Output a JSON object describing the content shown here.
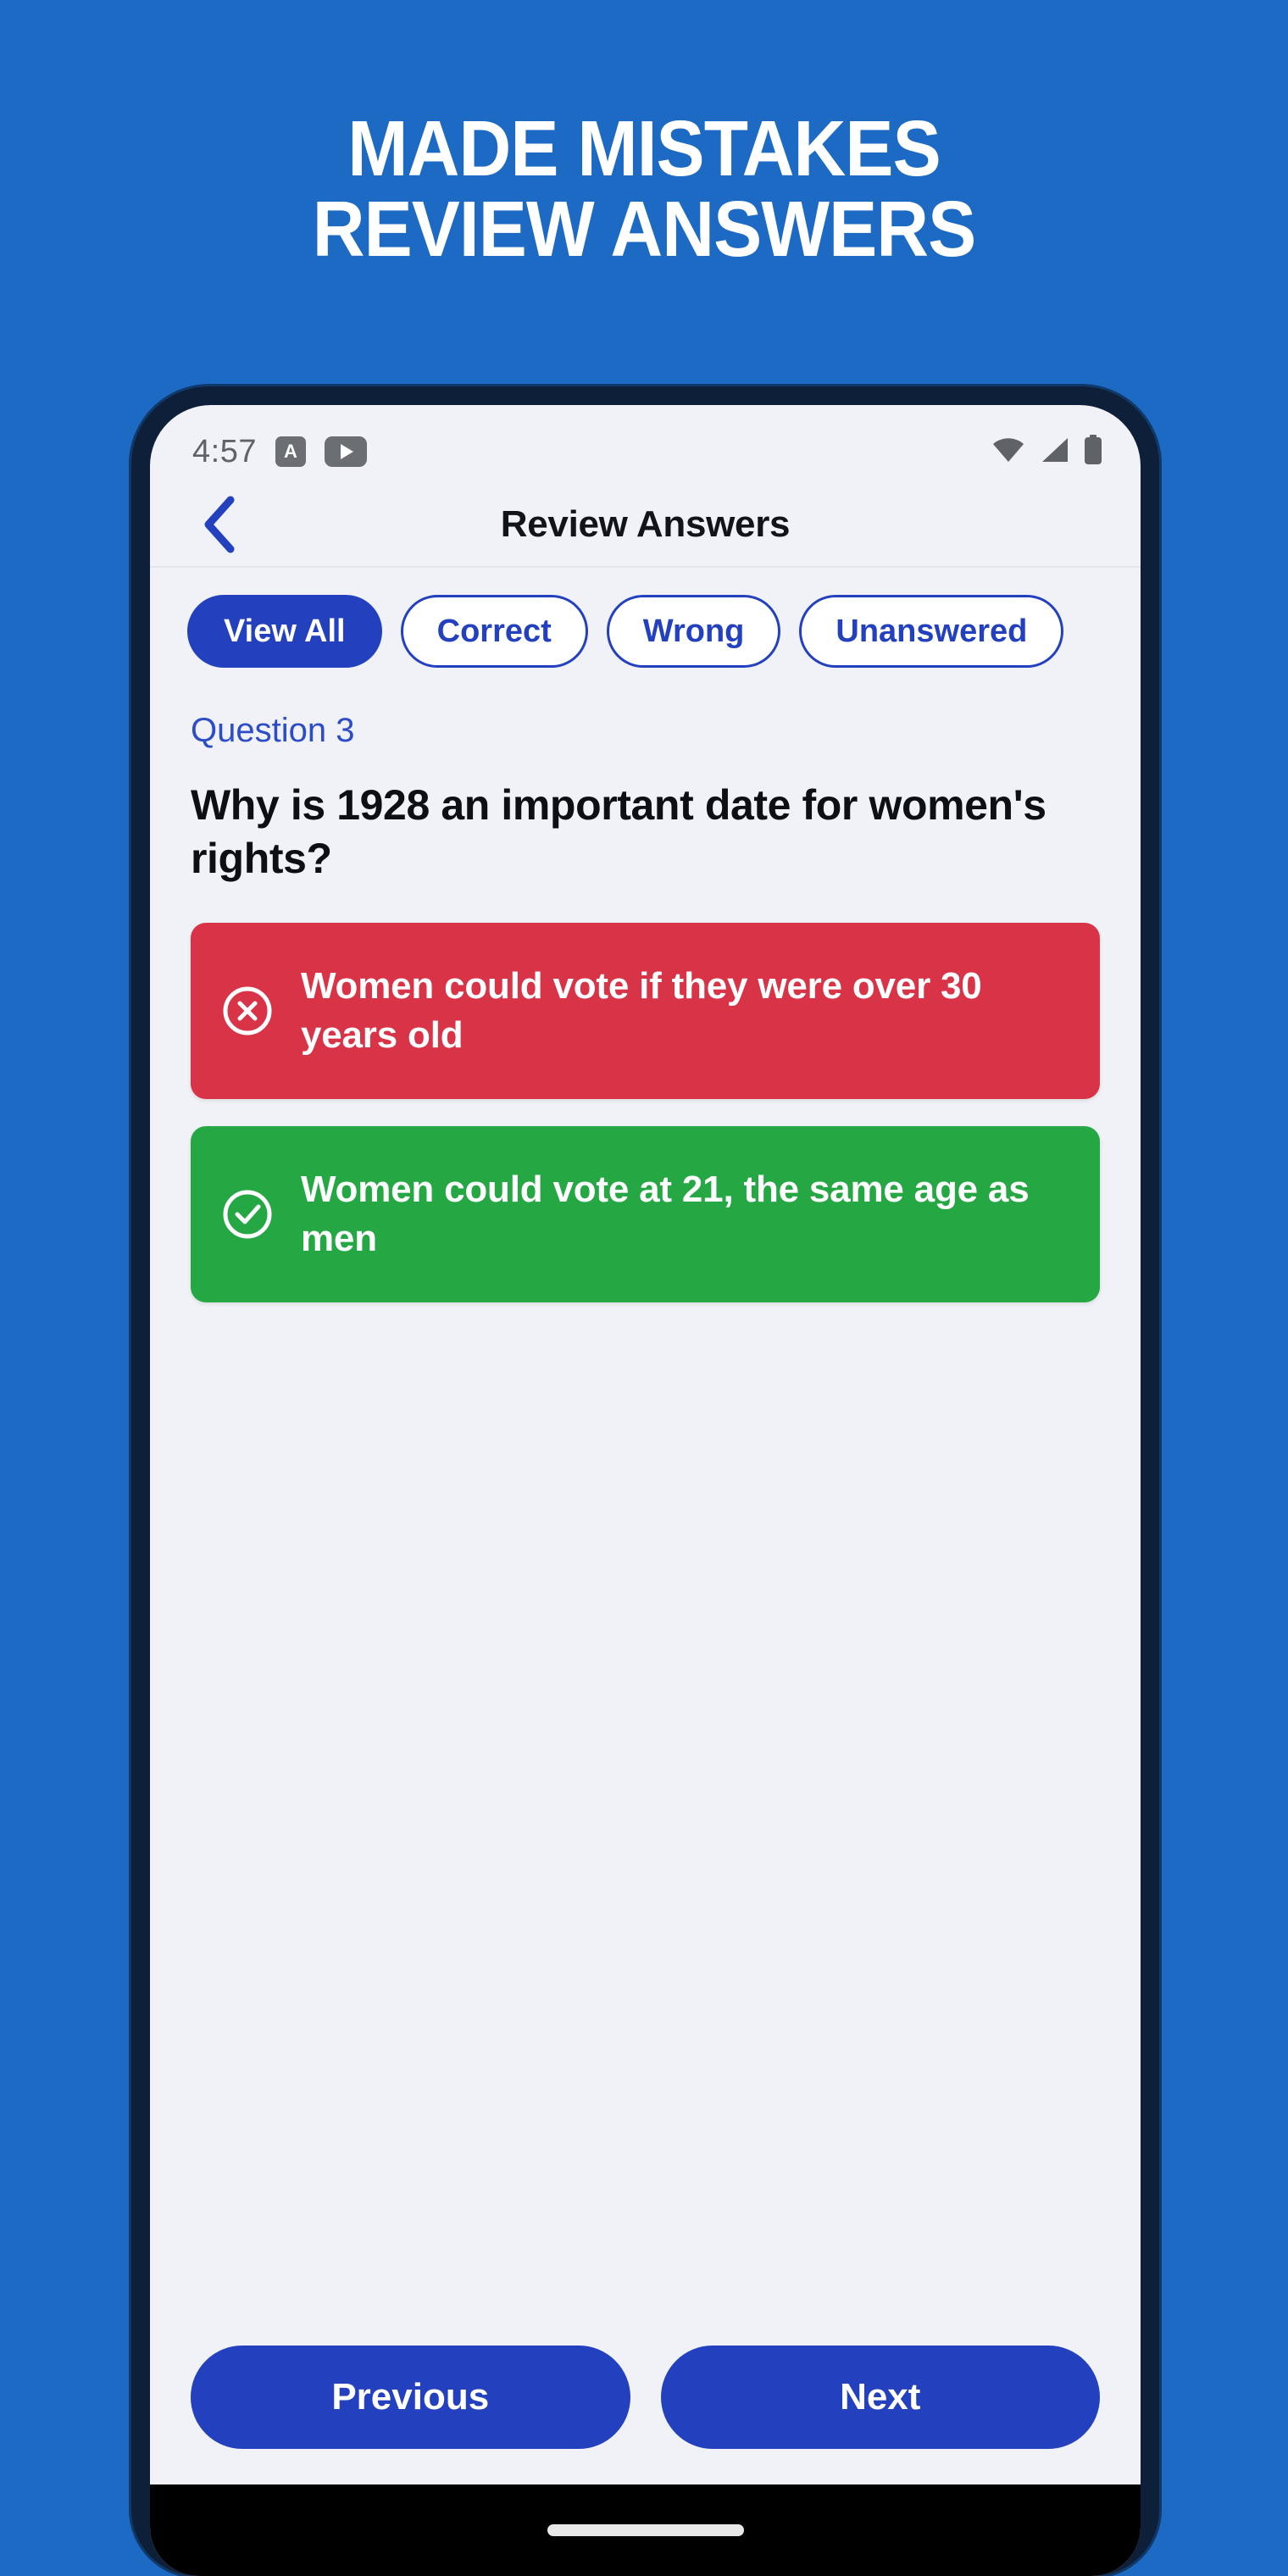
{
  "promo": {
    "headline_line1": "MADE MISTAKES",
    "headline_line2": "REVIEW ANSWERS",
    "background_color": "#1C6AC4"
  },
  "statusbar": {
    "time": "4:57",
    "badge_label": "A",
    "icons": [
      "app-badge-icon",
      "media-play-icon",
      "wifi-icon",
      "cellular-signal-icon",
      "battery-icon"
    ]
  },
  "appbar": {
    "title": "Review Answers",
    "back_icon": "chevron-left-icon"
  },
  "filters": {
    "chips": [
      {
        "label": "View All",
        "active": true
      },
      {
        "label": "Correct",
        "active": false
      },
      {
        "label": "Wrong",
        "active": false
      },
      {
        "label": "Unanswered",
        "active": false
      }
    ]
  },
  "question": {
    "number_label": "Question 3",
    "text": "Why is 1928 an important date for women's rights?"
  },
  "answers": [
    {
      "text": "Women could vote if they were over 30 years old",
      "state": "wrong",
      "icon": "circle-x-icon",
      "color": "#D93347"
    },
    {
      "text": "Women could vote at 21, the same age as men",
      "state": "correct",
      "icon": "circle-check-icon",
      "color": "#25A744"
    }
  ],
  "navigation": {
    "previous_label": "Previous",
    "next_label": "Next",
    "button_color": "#2340BE"
  },
  "theme": {
    "accent_blue": "#2340BE",
    "screen_background": "#F0F2F7",
    "bezel": "#0E2039"
  }
}
